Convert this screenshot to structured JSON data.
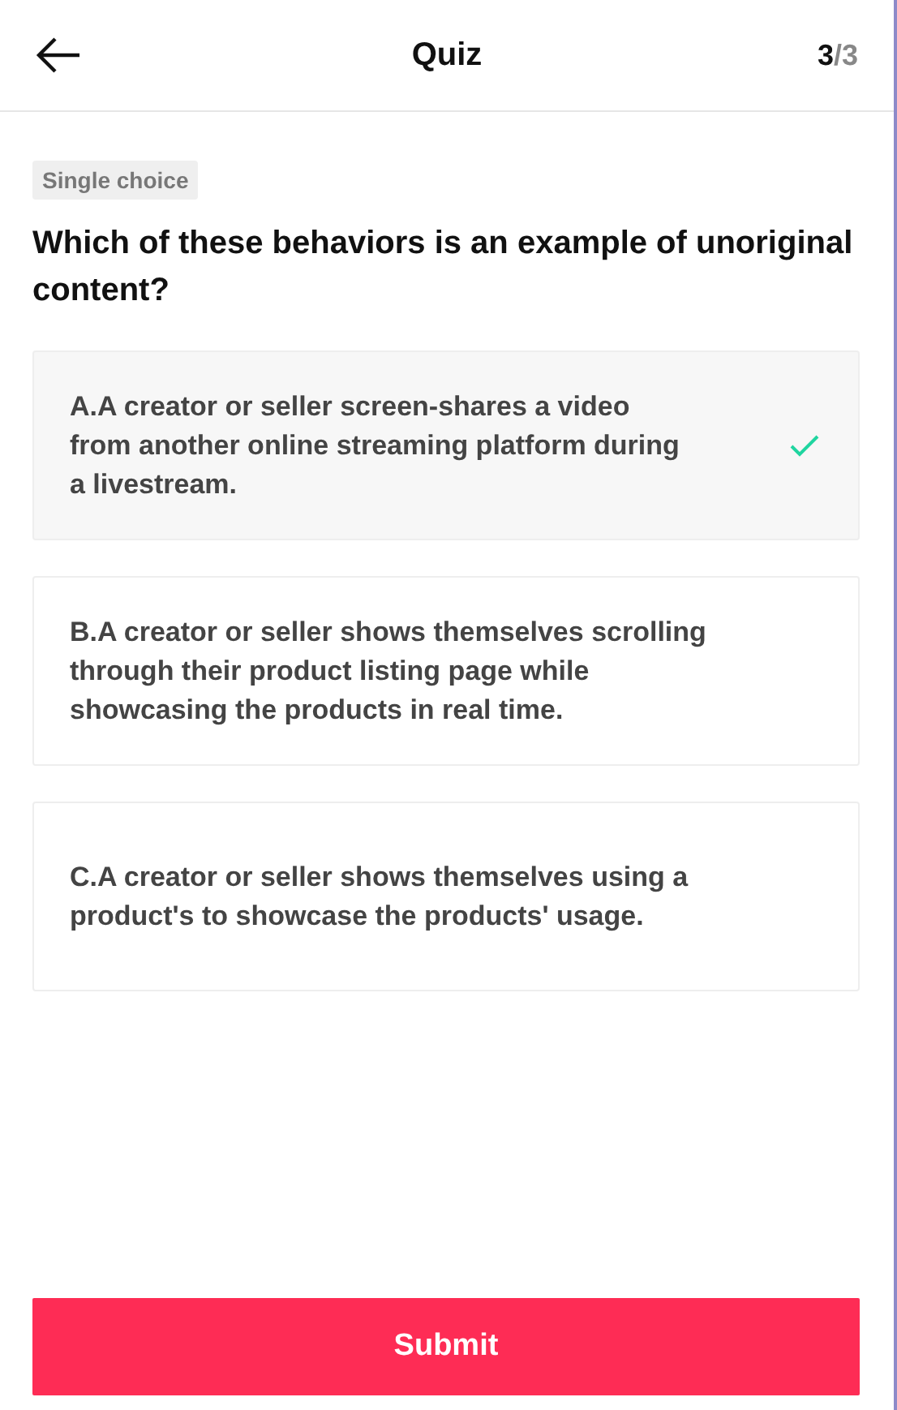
{
  "header": {
    "title": "Quiz",
    "progress_current": "3",
    "progress_total": "/3"
  },
  "question": {
    "type_tag": "Single choice",
    "text": "Which of these behaviors is an example of unoriginal content?"
  },
  "options": [
    {
      "text": "A.A creator or seller screen-shares a video from another online streaming platform during a livestream.",
      "selected": true
    },
    {
      "text": "B.A creator or seller shows themselves scrolling through their product listing page while showcasing the products in real time.",
      "selected": false
    },
    {
      "text": "C.A creator or seller shows themselves using a product's to showcase the products' usage.",
      "selected": false
    }
  ],
  "submit_button": {
    "label": "Submit"
  }
}
